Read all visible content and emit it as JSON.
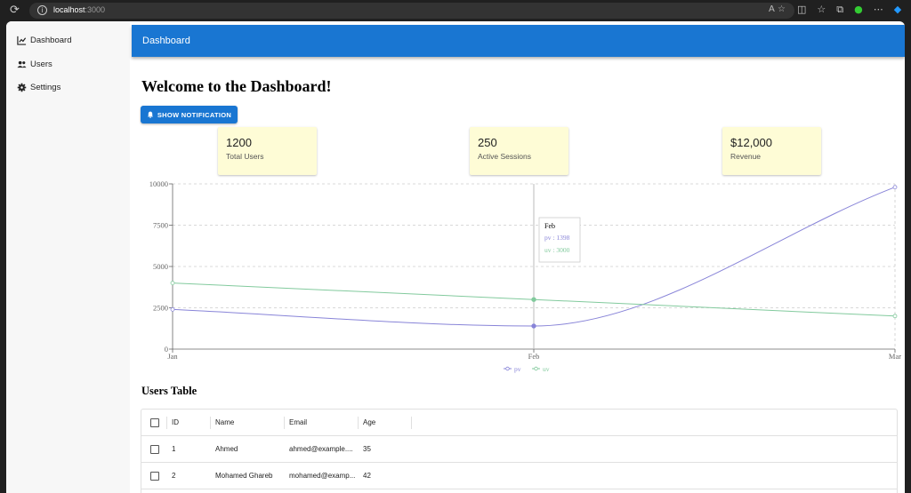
{
  "browser": {
    "url_host": "localhost",
    "url_port": ":3000",
    "reader_icon": "A",
    "star_icon": "☆"
  },
  "sidebar": {
    "items": [
      {
        "label": "Dashboard",
        "icon": "chart-line-icon"
      },
      {
        "label": "Users",
        "icon": "users-icon"
      },
      {
        "label": "Settings",
        "icon": "gear-icon"
      }
    ]
  },
  "appbar": {
    "title": "Dashboard"
  },
  "main": {
    "heading": "Welcome to the Dashboard!",
    "notify_button": "SHOW NOTIFICATION",
    "stats": [
      {
        "value": "1200",
        "label": "Total Users"
      },
      {
        "value": "250",
        "label": "Active Sessions"
      },
      {
        "value": "$12,000",
        "label": "Revenue"
      }
    ],
    "table_title": "Users Table"
  },
  "chart_data": {
    "type": "line",
    "categories": [
      "Jan",
      "Feb",
      "Mar"
    ],
    "series": [
      {
        "name": "pv",
        "values": [
          2400,
          1398,
          9800
        ],
        "color": "#8884d8"
      },
      {
        "name": "uv",
        "values": [
          4000,
          3000,
          2000
        ],
        "color": "#82ca9d"
      }
    ],
    "yticks": [
      0,
      2500,
      5000,
      7500,
      10000
    ],
    "ylim": [
      0,
      10000
    ],
    "grid": true,
    "legend": "bottom-center",
    "tooltip": {
      "title": "Feb",
      "lines": [
        "pv : 1398",
        "uv : 3000"
      ]
    }
  },
  "table": {
    "headers": [
      "ID",
      "Name",
      "Email",
      "Age"
    ],
    "rows": [
      [
        "1",
        "Ahmed",
        "ahmed@example....",
        "35"
      ],
      [
        "2",
        "Mohamed Ghareb",
        "mohamed@examp...",
        "42"
      ]
    ]
  }
}
